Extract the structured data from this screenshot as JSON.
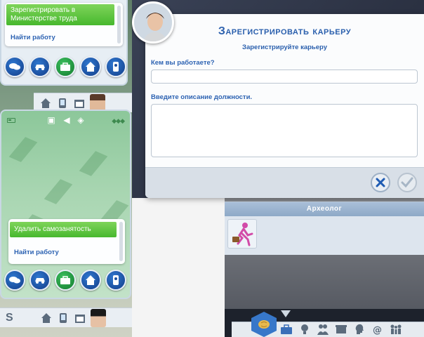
{
  "top_phone": {
    "menu_selected": "Зарегистрировать в Министерстве труда",
    "menu_link": "Найти работу",
    "nav_buttons": [
      "chat-icon",
      "car-icon",
      "career-icon",
      "home-icon",
      "remote-icon"
    ]
  },
  "main_phone": {
    "status_icons": [
      "battery-icon",
      "camera-icon",
      "sound-icon",
      "settings-icon",
      "signal-icon"
    ],
    "menu_selected": "Удалить самозанятость",
    "menu_link": "Найти работу",
    "nav_buttons": [
      "chat-icon",
      "car-icon",
      "career-icon",
      "home-icon",
      "remote-icon"
    ]
  },
  "dialog": {
    "title": "Зарегистрировать карьеру",
    "subtitle": "Зарегистрируйте карьеру",
    "job_label": "Кем вы работаете?",
    "job_value": "",
    "description_label": "Введите описание должности.",
    "description_value": "",
    "cancel_icon": "close-icon",
    "confirm_icon": "check-icon"
  },
  "career_panel": {
    "title": "Археолог",
    "icon": "runner-briefcase-icon"
  },
  "strip_left": {
    "letter": "S"
  },
  "colors": {
    "accent_blue": "#2a5fad",
    "menu_green": "#47b82e",
    "nav_blue": "#1c4f9e"
  }
}
